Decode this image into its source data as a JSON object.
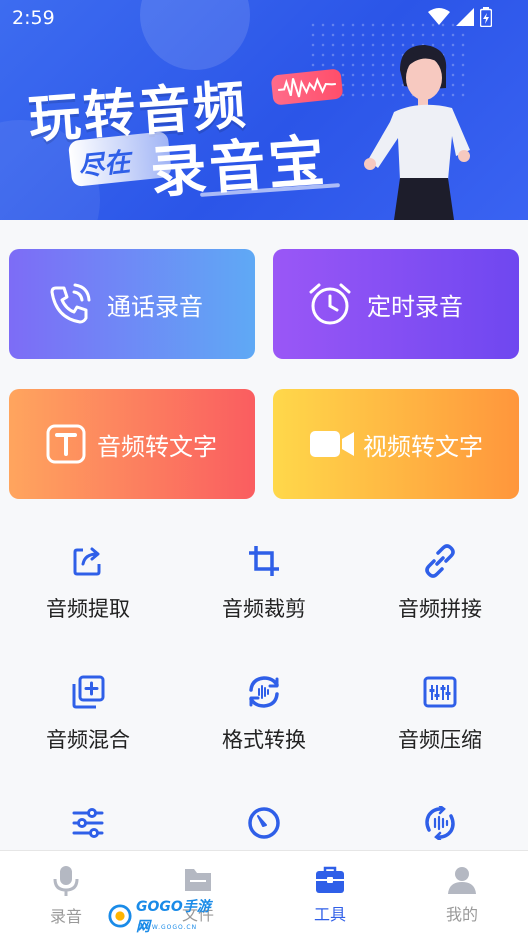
{
  "status_bar": {
    "time": "2:59"
  },
  "banner": {
    "headline_line1": "玩转音频",
    "tag": "尽在",
    "headline_line2": "录音宝"
  },
  "feature_cards": [
    {
      "label": "通话录音",
      "icon": "phone-icon"
    },
    {
      "label": "定时录音",
      "icon": "alarm-clock-icon"
    },
    {
      "label": "音频转文字",
      "icon": "text-t-icon"
    },
    {
      "label": "视频转文字",
      "icon": "video-camera-icon"
    }
  ],
  "tools": [
    {
      "label": "音频提取",
      "icon": "extract-icon"
    },
    {
      "label": "音频裁剪",
      "icon": "crop-icon"
    },
    {
      "label": "音频拼接",
      "icon": "link-icon"
    },
    {
      "label": "音频混合",
      "icon": "mix-icon"
    },
    {
      "label": "格式转换",
      "icon": "convert-icon"
    },
    {
      "label": "音频压缩",
      "icon": "compress-icon"
    },
    {
      "label": "",
      "icon": "sliders-icon"
    },
    {
      "label": "",
      "icon": "speed-dial-icon"
    },
    {
      "label": "",
      "icon": "loop-audio-icon"
    }
  ],
  "tab_bar": {
    "tabs": [
      {
        "label": "录音",
        "icon": "microphone-icon",
        "active": false
      },
      {
        "label": "文件",
        "icon": "folder-icon",
        "active": false
      },
      {
        "label": "工具",
        "icon": "toolbox-icon",
        "active": true
      },
      {
        "label": "我的",
        "icon": "user-icon",
        "active": false
      }
    ]
  },
  "watermark": {
    "text": "GOGO手游网",
    "sub": "WWW.GOGO.CN"
  },
  "colors": {
    "accent": "#2f5fe8",
    "banner": "#3d6cf0",
    "tool_icon": "#2f5fe8"
  }
}
